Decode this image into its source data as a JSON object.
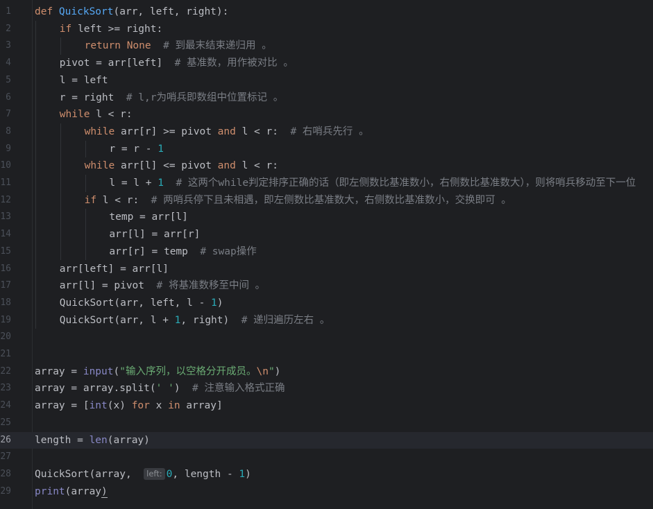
{
  "editor": {
    "language": "python",
    "current_line": 26,
    "lines": [
      {
        "n": "1",
        "indent": 0,
        "segs": [
          [
            "kw",
            "def "
          ],
          [
            "fn",
            "QuickSort"
          ],
          [
            "p",
            "(arr, left, right):"
          ]
        ]
      },
      {
        "n": "2",
        "indent": 1,
        "segs": [
          [
            "kw",
            "if "
          ],
          [
            "p",
            "left >= right:"
          ]
        ]
      },
      {
        "n": "3",
        "indent": 2,
        "segs": [
          [
            "kw",
            "return "
          ],
          [
            "none",
            "None"
          ],
          [
            "p",
            "  "
          ],
          [
            "cm",
            "# 到最末结束递归用 。"
          ]
        ]
      },
      {
        "n": "4",
        "indent": 1,
        "segs": [
          [
            "p",
            "pivot = arr[left]  "
          ],
          [
            "cm",
            "# 基准数，用作被对比 。"
          ]
        ]
      },
      {
        "n": "5",
        "indent": 1,
        "segs": [
          [
            "p",
            "l = left"
          ]
        ]
      },
      {
        "n": "6",
        "indent": 1,
        "segs": [
          [
            "p",
            "r = right  "
          ],
          [
            "cm",
            "# l,r为哨兵即数组中位置标记 。"
          ]
        ]
      },
      {
        "n": "7",
        "indent": 1,
        "segs": [
          [
            "kw",
            "while "
          ],
          [
            "p",
            "l < r:"
          ]
        ]
      },
      {
        "n": "8",
        "indent": 2,
        "segs": [
          [
            "kw",
            "while "
          ],
          [
            "p",
            "arr[r] >= pivot "
          ],
          [
            "kw",
            "and "
          ],
          [
            "p",
            "l < r:  "
          ],
          [
            "cm",
            "# 右哨兵先行 。"
          ]
        ]
      },
      {
        "n": "9",
        "indent": 3,
        "segs": [
          [
            "p",
            "r = r - "
          ],
          [
            "num",
            "1"
          ]
        ]
      },
      {
        "n": "10",
        "indent": 2,
        "segs": [
          [
            "kw",
            "while "
          ],
          [
            "p",
            "arr[l] <= pivot "
          ],
          [
            "kw",
            "and "
          ],
          [
            "p",
            "l < r:"
          ]
        ]
      },
      {
        "n": "11",
        "indent": 3,
        "segs": [
          [
            "p",
            "l = l + "
          ],
          [
            "num",
            "1"
          ],
          [
            "p",
            "  "
          ],
          [
            "cm",
            "# 这两个while判定排序正确的话（即左侧数比基准数小，右侧数比基准数大），则将哨兵移动至下一位"
          ]
        ]
      },
      {
        "n": "12",
        "indent": 2,
        "segs": [
          [
            "kw",
            "if "
          ],
          [
            "p",
            "l < r:  "
          ],
          [
            "cm",
            "# 两哨兵停下且未相遇，即左侧数比基准数大，右侧数比基准数小，交换即可 。"
          ]
        ]
      },
      {
        "n": "13",
        "indent": 3,
        "segs": [
          [
            "p",
            "temp = arr[l]"
          ]
        ]
      },
      {
        "n": "14",
        "indent": 3,
        "segs": [
          [
            "p",
            "arr[l] = arr[r]"
          ]
        ]
      },
      {
        "n": "15",
        "indent": 3,
        "segs": [
          [
            "p",
            "arr[r] = temp  "
          ],
          [
            "cm",
            "# swap操作"
          ]
        ]
      },
      {
        "n": "16",
        "indent": 1,
        "segs": [
          [
            "p",
            "arr[left] = arr[l]"
          ]
        ]
      },
      {
        "n": "17",
        "indent": 1,
        "segs": [
          [
            "p",
            "arr[l] = pivot  "
          ],
          [
            "cm",
            "# 将基准数移至中间 。"
          ]
        ]
      },
      {
        "n": "18",
        "indent": 1,
        "segs": [
          [
            "p",
            "QuickSort(arr, left, l - "
          ],
          [
            "num",
            "1"
          ],
          [
            "p",
            ")"
          ]
        ]
      },
      {
        "n": "19",
        "indent": 1,
        "segs": [
          [
            "p",
            "QuickSort(arr, l + "
          ],
          [
            "num",
            "1"
          ],
          [
            "p",
            ", right)  "
          ],
          [
            "cm",
            "# 递归遍历左右 。"
          ]
        ]
      },
      {
        "n": "20",
        "indent": 0,
        "segs": []
      },
      {
        "n": "21",
        "indent": 0,
        "segs": []
      },
      {
        "n": "22",
        "indent": 0,
        "segs": [
          [
            "p",
            "array = "
          ],
          [
            "bi",
            "input"
          ],
          [
            "p",
            "("
          ],
          [
            "str",
            "\"输入序列，以空格分开成员。"
          ],
          [
            "esc",
            "\\n"
          ],
          [
            "str",
            "\""
          ],
          [
            "p",
            ")"
          ]
        ]
      },
      {
        "n": "23",
        "indent": 0,
        "segs": [
          [
            "p",
            "array = array.split("
          ],
          [
            "str",
            "' '"
          ],
          [
            "p",
            ")  "
          ],
          [
            "cm",
            "# 注意输入格式正确"
          ]
        ]
      },
      {
        "n": "24",
        "indent": 0,
        "segs": [
          [
            "p",
            "array = ["
          ],
          [
            "bi",
            "int"
          ],
          [
            "p",
            "(x) "
          ],
          [
            "kw",
            "for "
          ],
          [
            "p",
            "x "
          ],
          [
            "kw",
            "in "
          ],
          [
            "p",
            "array]"
          ]
        ]
      },
      {
        "n": "25",
        "indent": 0,
        "segs": []
      },
      {
        "n": "26",
        "indent": 0,
        "segs": [
          [
            "p",
            "length = "
          ],
          [
            "bi",
            "len"
          ],
          [
            "p",
            "(array)"
          ]
        ]
      },
      {
        "n": "27",
        "indent": 0,
        "segs": []
      },
      {
        "n": "28",
        "indent": 0,
        "segs": [
          [
            "p",
            "QuickSort(array,  "
          ],
          [
            "hint",
            "left:"
          ],
          [
            "num",
            "0"
          ],
          [
            "p",
            ", length - "
          ],
          [
            "num",
            "1"
          ],
          [
            "p",
            ")"
          ]
        ]
      },
      {
        "n": "29",
        "indent": 0,
        "segs": [
          [
            "bi",
            "print"
          ],
          [
            "p",
            "(array"
          ],
          [
            "cur",
            ")"
          ]
        ]
      }
    ]
  },
  "colors": {
    "background": "#1e1f22",
    "current_line": "#26282e",
    "keyword": "#cf8e6d",
    "function": "#56a8f5",
    "builtin": "#8888c6",
    "number": "#2aacb8",
    "string": "#6aab73",
    "comment": "#7a7e85",
    "text": "#bcbec4"
  }
}
